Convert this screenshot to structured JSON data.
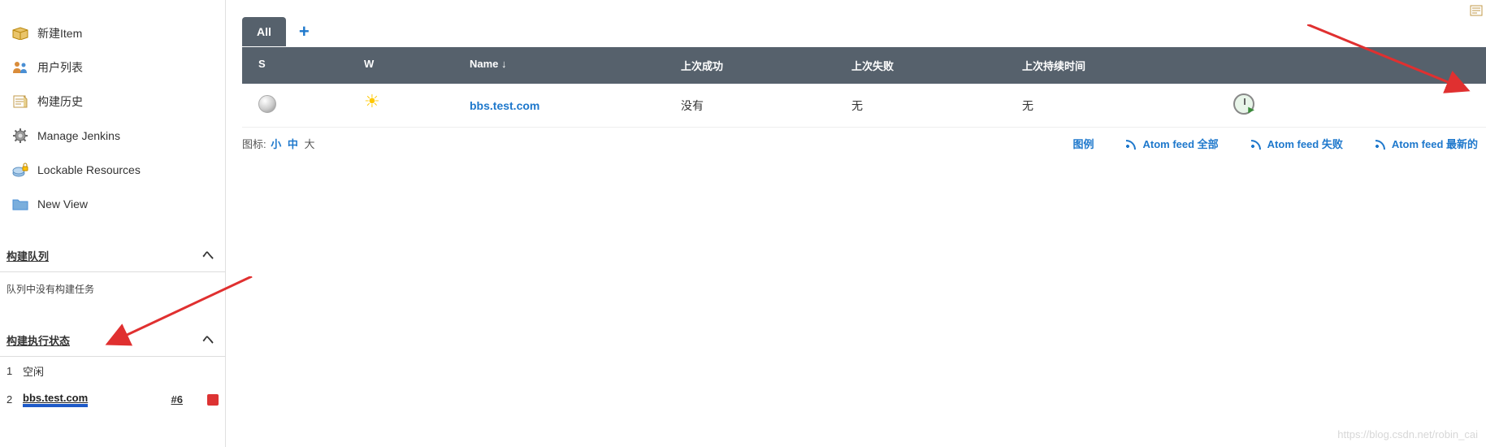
{
  "sidebar": {
    "items": [
      {
        "label": "新建Item"
      },
      {
        "label": "用户列表"
      },
      {
        "label": "构建历史"
      },
      {
        "label": "Manage Jenkins"
      },
      {
        "label": "Lockable Resources"
      },
      {
        "label": "New View"
      }
    ]
  },
  "buildQueue": {
    "title": "构建队列",
    "emptyMsg": "队列中没有构建任务"
  },
  "executors": {
    "title": "构建执行状态",
    "rows": [
      {
        "num": "1",
        "label": "空闲"
      },
      {
        "num": "2",
        "label": "bbs.test.com",
        "build": "#6"
      }
    ]
  },
  "tabs": {
    "all": "All"
  },
  "table": {
    "headers": {
      "s": "S",
      "w": "W",
      "name": "Name ↓",
      "lastSuccess": "上次成功",
      "lastFailure": "上次失败",
      "lastDuration": "上次持续时间"
    },
    "rows": [
      {
        "name": "bbs.test.com",
        "lastSuccess": "没有",
        "lastFailure": "无",
        "lastDuration": "无"
      }
    ]
  },
  "iconSize": {
    "label": "图标:",
    "small": "小",
    "medium": "中",
    "large": "大"
  },
  "feeds": {
    "legend": "图例",
    "all": "Atom feed 全部",
    "fail": "Atom feed 失败",
    "latest": "Atom feed 最新的"
  },
  "watermark": "https://blog.csdn.net/robin_cai"
}
